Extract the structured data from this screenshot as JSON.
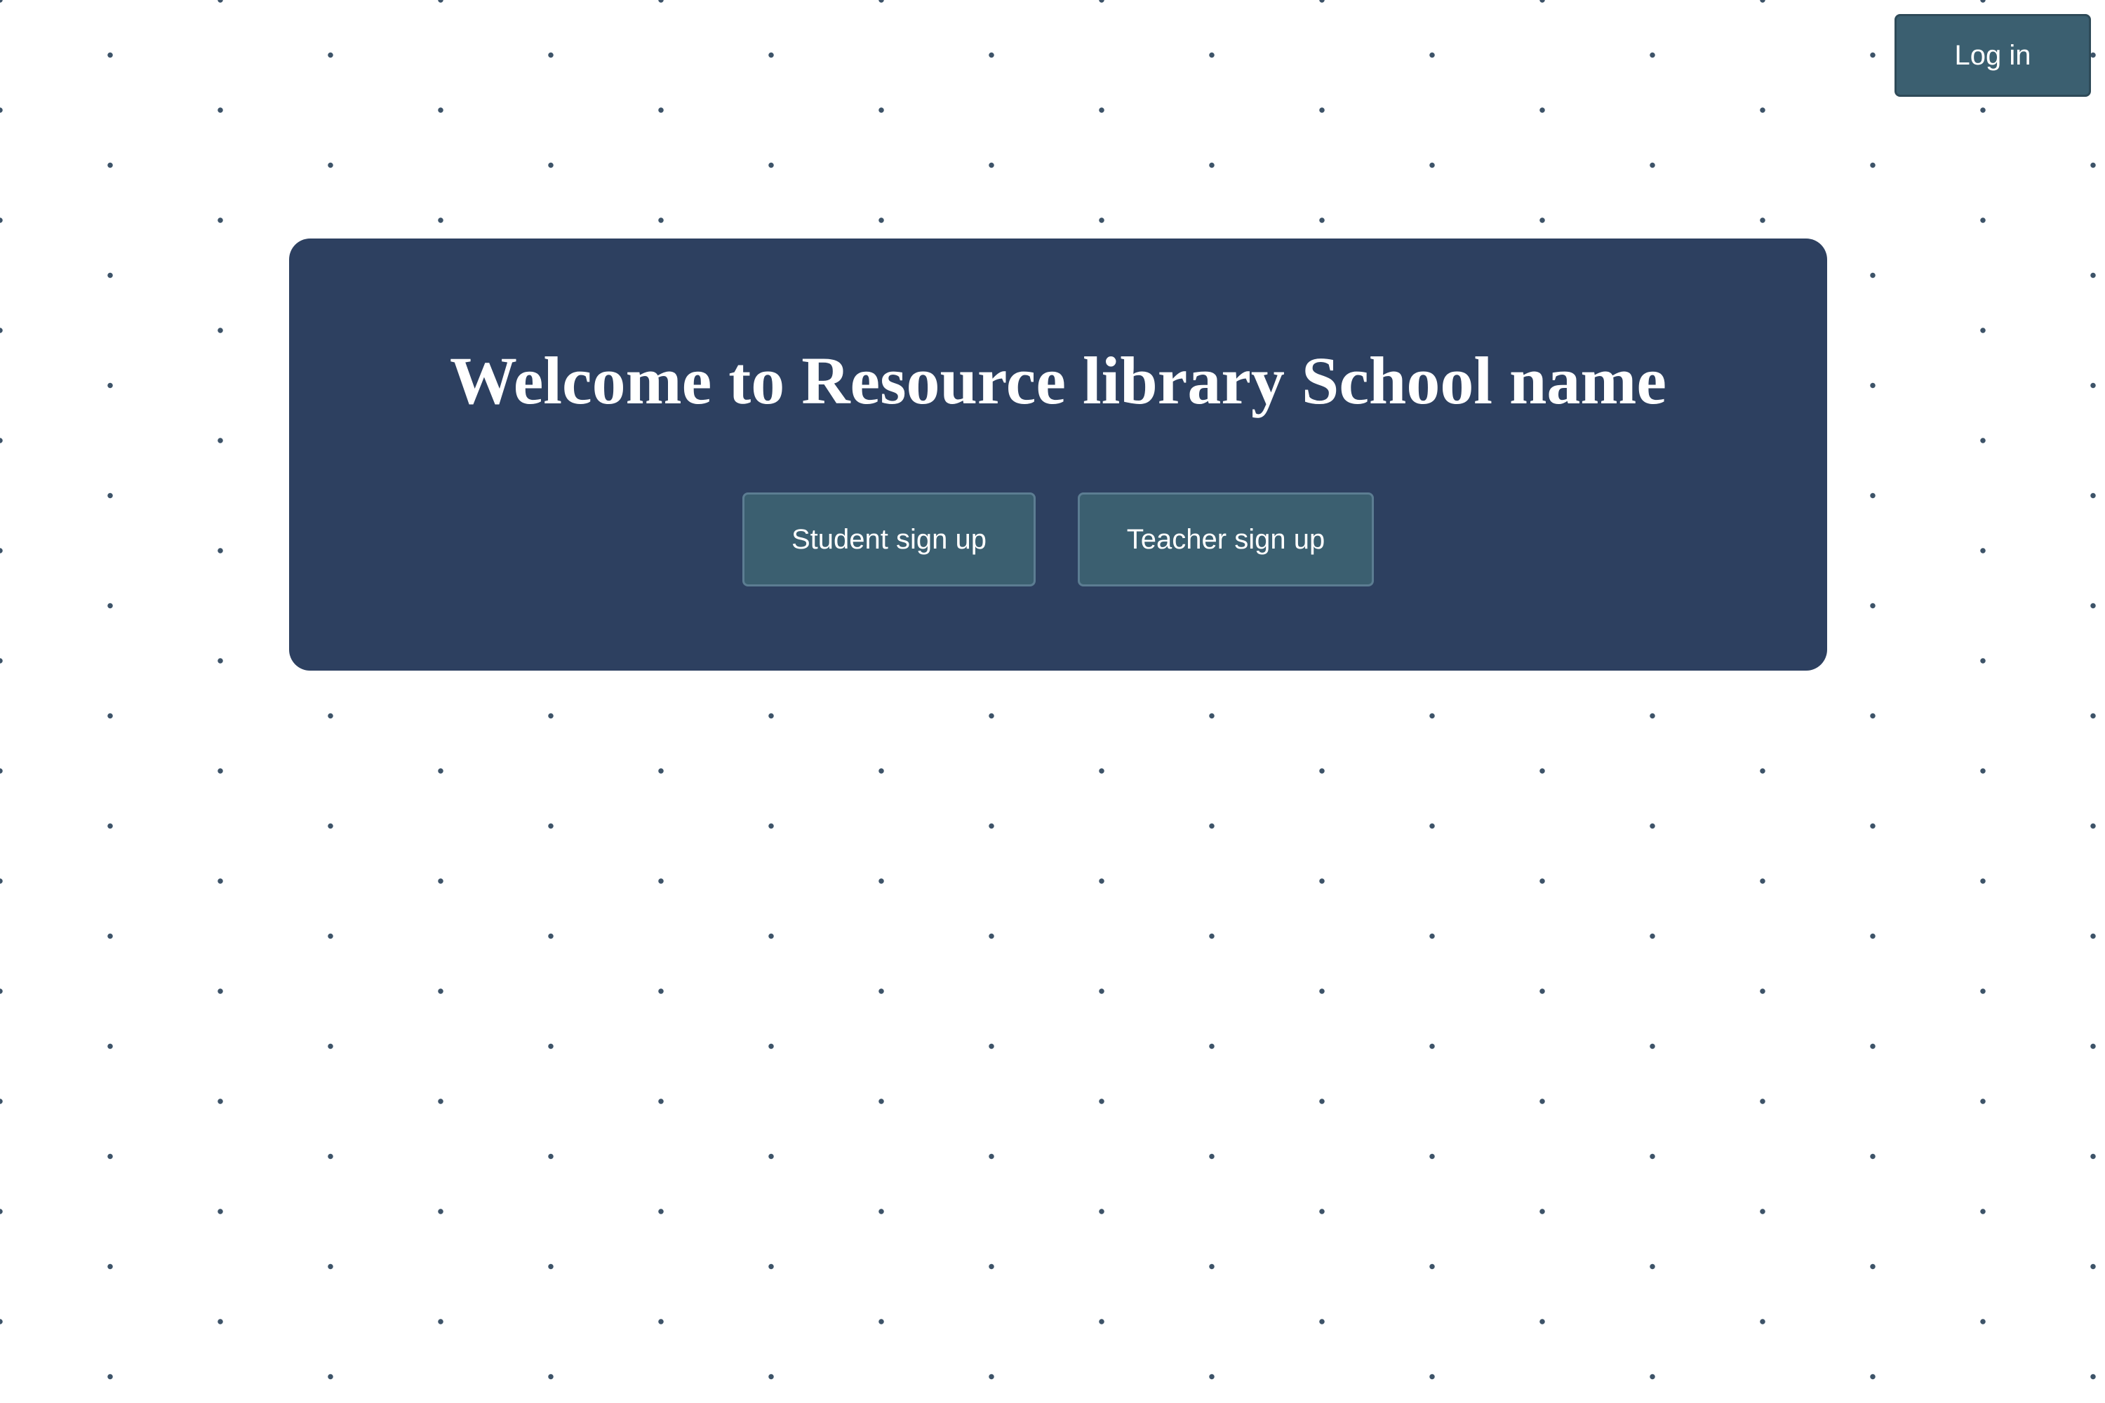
{
  "header": {
    "login_label": "Log in"
  },
  "hero": {
    "title": "Welcome to Resource library School name",
    "student_signup_label": "Student sign up",
    "teacher_signup_label": "Teacher sign up"
  },
  "colors": {
    "background": "#ffffff",
    "dot": "#3d5368",
    "panel": "#2d4060",
    "button": "#3b5f70",
    "text": "#ffffff"
  }
}
